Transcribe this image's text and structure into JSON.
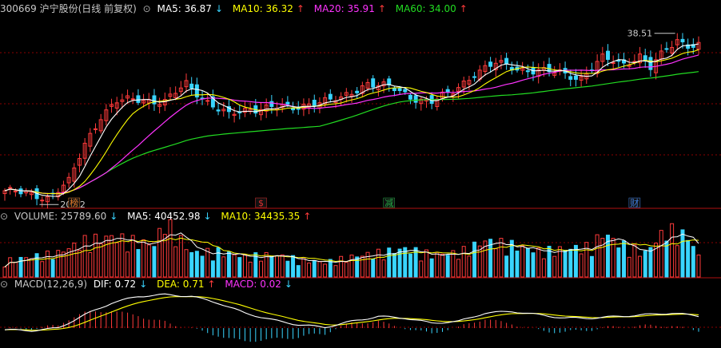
{
  "header": {
    "title": "300669 沪宁股份(日线 前复权)",
    "ma5_label": "MA5: 36.87",
    "ma5_arrow": "↓",
    "ma10_label": "MA10: 36.32",
    "ma10_arrow": "↑",
    "ma20_label": "MA20: 35.91",
    "ma20_arrow": "↑",
    "ma60_label": "MA60: 34.00",
    "ma60_arrow": "↑"
  },
  "volume_header": {
    "volume_label": "VOLUME: 25789.60",
    "volume_arrow": "↓",
    "ma5_label": "MA5: 40452.98",
    "ma5_arrow": "↓",
    "ma10_label": "MA10: 34435.35",
    "ma10_arrow": "↑"
  },
  "macd_header": {
    "params": "MACD(12,26,9)",
    "dif_label": "DIF: 0.72",
    "dif_arrow": "↓",
    "dea_label": "DEA: 0.71",
    "dea_arrow": "↑",
    "macd_label": "MACD: 0.02",
    "macd_arrow": "↓"
  },
  "annotations": {
    "high_label": "38.51",
    "low_label": "20.82"
  },
  "event_markers": [
    {
      "label": "榜",
      "color": "#e07a2a"
    },
    {
      "label": "$",
      "color": "#e03030"
    },
    {
      "label": "减",
      "color": "#22aa44"
    },
    {
      "label": "财",
      "color": "#3f7fe0"
    }
  ],
  "colors": {
    "background": "#000000",
    "up": "#ff3b3b",
    "down": "#39d5ff",
    "ma5": "#ffffff",
    "ma10": "#ffff00",
    "ma20": "#ff33ff",
    "ma60": "#22dd22",
    "grid": "#8b0000",
    "title": "#c8c8c8"
  },
  "chart_data": [
    {
      "type": "candlestick",
      "title": "300669 沪宁股份(日线 前复权)",
      "x_index": [
        0,
        130
      ],
      "ylim": [
        20,
        40
      ],
      "keypoints_close": [
        [
          0,
          21.6
        ],
        [
          5,
          21.2
        ],
        [
          8,
          20.9
        ],
        [
          12,
          22.5
        ],
        [
          15,
          26.5
        ],
        [
          18,
          29.5
        ],
        [
          21,
          31.0
        ],
        [
          25,
          31.2
        ],
        [
          30,
          31.0
        ],
        [
          34,
          32.8
        ],
        [
          38,
          31.0
        ],
        [
          42,
          29.5
        ],
        [
          46,
          30.2
        ],
        [
          50,
          30.5
        ],
        [
          54,
          30.2
        ],
        [
          58,
          31.0
        ],
        [
          63,
          31.2
        ],
        [
          68,
          33.0
        ],
        [
          72,
          32.5
        ],
        [
          76,
          31.5
        ],
        [
          80,
          31.0
        ],
        [
          84,
          32.0
        ],
        [
          88,
          34.0
        ],
        [
          92,
          35.0
        ],
        [
          96,
          34.5
        ],
        [
          100,
          34.2
        ],
        [
          104,
          34.0
        ],
        [
          108,
          33.5
        ],
        [
          112,
          35.5
        ],
        [
          116,
          35.0
        ],
        [
          119,
          35.8
        ],
        [
          121,
          34.5
        ],
        [
          124,
          36.5
        ],
        [
          126,
          37.5
        ],
        [
          128,
          37.0
        ],
        [
          130,
          36.9
        ]
      ],
      "ma5_last": 36.87,
      "ma10_last": 36.32,
      "ma20_last": 35.91,
      "ma60_last": 34.0,
      "period_high": 38.51,
      "period_low": 20.82
    },
    {
      "type": "bar",
      "title": "VOLUME",
      "x_index": [
        0,
        130
      ],
      "ylim": [
        0,
        75000
      ],
      "keypoints_volume": [
        [
          0,
          20000
        ],
        [
          10,
          30000
        ],
        [
          15,
          45000
        ],
        [
          20,
          50000
        ],
        [
          28,
          40000
        ],
        [
          30,
          70000
        ],
        [
          35,
          30000
        ],
        [
          40,
          32000
        ],
        [
          45,
          25000
        ],
        [
          50,
          28000
        ],
        [
          55,
          22000
        ],
        [
          60,
          18000
        ],
        [
          65,
          25000
        ],
        [
          70,
          30000
        ],
        [
          75,
          35000
        ],
        [
          80,
          28000
        ],
        [
          85,
          30000
        ],
        [
          90,
          45000
        ],
        [
          95,
          40000
        ],
        [
          100,
          32000
        ],
        [
          105,
          35000
        ],
        [
          110,
          38000
        ],
        [
          112,
          55000
        ],
        [
          115,
          42000
        ],
        [
          120,
          30000
        ],
        [
          124,
          60000
        ],
        [
          126,
          55000
        ],
        [
          128,
          50000
        ],
        [
          130,
          25789.6
        ]
      ],
      "volume_last": 25789.6,
      "ma5_last": 40452.98,
      "ma10_last": 34435.35
    },
    {
      "type": "bar",
      "title": "MACD(12,26,9)",
      "x_index": [
        0,
        130
      ],
      "ylim": [
        -1.0,
        2.2
      ],
      "keypoints_dif": [
        [
          0,
          -0.1
        ],
        [
          5,
          -0.15
        ],
        [
          10,
          0.0
        ],
        [
          15,
          0.8
        ],
        [
          20,
          1.5
        ],
        [
          25,
          1.9
        ],
        [
          30,
          2.0
        ],
        [
          35,
          1.9
        ],
        [
          40,
          1.5
        ],
        [
          45,
          0.9
        ],
        [
          50,
          0.5
        ],
        [
          55,
          0.2
        ],
        [
          60,
          0.05
        ],
        [
          65,
          0.4
        ],
        [
          70,
          0.7
        ],
        [
          75,
          0.6
        ],
        [
          80,
          0.3
        ],
        [
          85,
          0.4
        ],
        [
          90,
          0.9
        ],
        [
          95,
          1.0
        ],
        [
          100,
          0.8
        ],
        [
          105,
          0.6
        ],
        [
          110,
          0.6
        ],
        [
          115,
          0.7
        ],
        [
          120,
          0.8
        ],
        [
          125,
          0.9
        ],
        [
          130,
          0.72
        ]
      ],
      "dif_last": 0.72,
      "dea_last": 0.71,
      "macd_last": 0.02
    }
  ]
}
